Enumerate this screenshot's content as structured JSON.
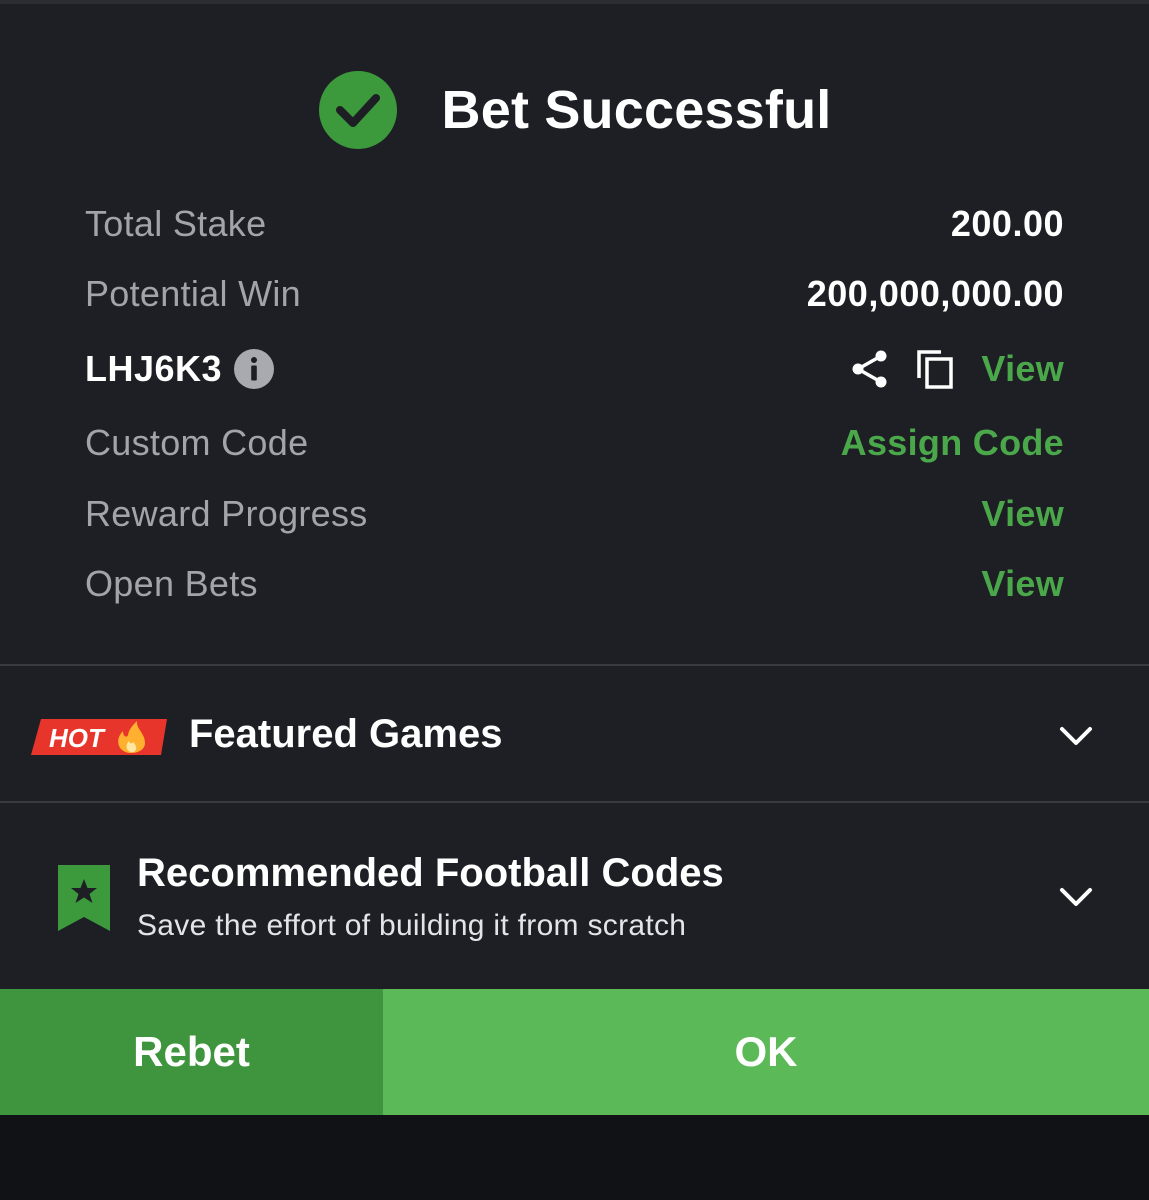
{
  "header": {
    "title": "Bet Successful",
    "icon": "check-circle-icon",
    "icon_color": "#3c9a3c"
  },
  "summary": {
    "total_stake_label": "Total Stake",
    "total_stake_value": "200.00",
    "potential_win_label": "Potential Win",
    "potential_win_value": "200,000,000.00",
    "booking_code": "LHJ6K3",
    "booking_view_label": "View",
    "custom_code_label": "Custom Code",
    "custom_code_action": "Assign Code",
    "reward_progress_label": "Reward Progress",
    "reward_progress_action": "View",
    "open_bets_label": "Open Bets",
    "open_bets_action": "View"
  },
  "featured": {
    "badge": "HOT",
    "title": "Featured Games"
  },
  "recommended": {
    "title": "Recommended Football Codes",
    "subtitle": "Save the effort of building it from scratch"
  },
  "actions": {
    "rebet_label": "Rebet",
    "ok_label": "OK"
  },
  "colors": {
    "accent_green": "#4aa84a",
    "rebet_bg": "#3f953e",
    "ok_bg": "#5cb957",
    "hot_red": "#e8352b",
    "panel_bg": "#1e1f24"
  }
}
